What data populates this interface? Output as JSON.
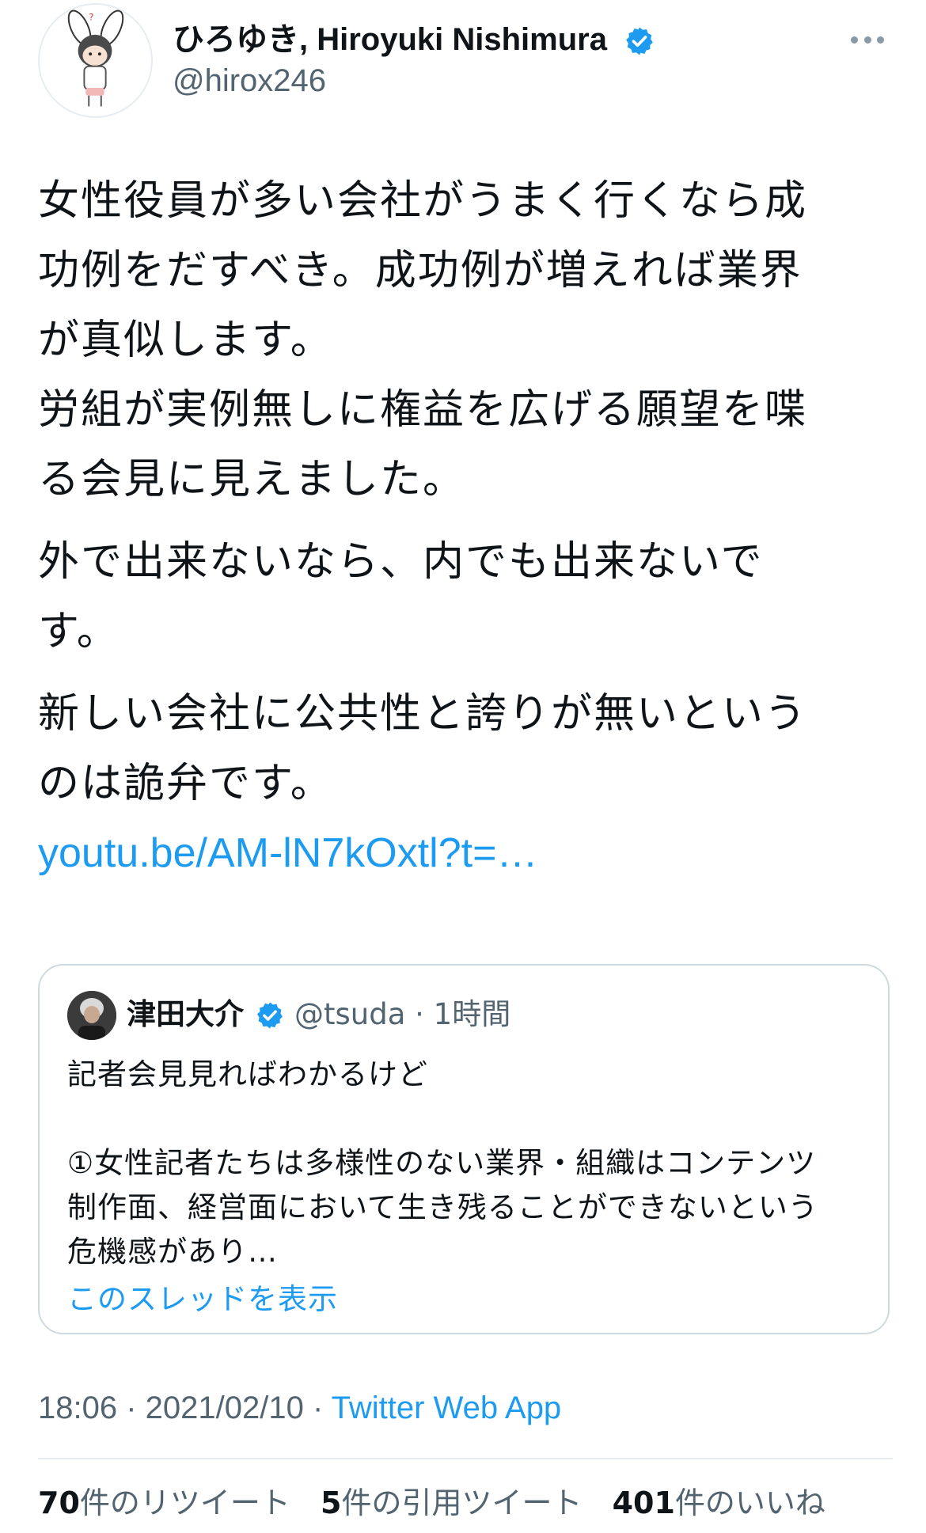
{
  "author": {
    "display_name": "ひろゆき, Hiroyuki Nishimura",
    "handle": "@hirox246",
    "verified_icon": "verified-badge-icon",
    "avatar_icon": "avatar-rabbit-eared-character"
  },
  "more_icon": "more-options-icon",
  "tweet": {
    "paragraphs": [
      [
        "女性役員が多い会社がうまく行くなら成",
        "功例をだすべき。成功例が増えれば業界",
        "が真似します。",
        "労組が実例無しに権益を広げる願望を喋",
        "る会見に見えました。"
      ],
      [
        "外で出来ないなら、内でも出来ないで",
        "す。"
      ],
      [
        "新しい会社に公共性と誇りが無いという",
        "のは詭弁です。"
      ]
    ],
    "link": "youtu.be/AM-lN7kOxtl?t=…"
  },
  "quote": {
    "name": "津田大介",
    "meta": "@tsuda · 1時間",
    "lines": [
      "記者会見見ればわかるけど",
      "",
      "①女性記者たちは多様性のない業界・組織はコンテンツ",
      "制作面、経営面において生き残ることができないという",
      "危機感があり…"
    ],
    "show_thread": "このスレッドを表示"
  },
  "meta": {
    "time_date": "18:06 · 2021/02/10 · ",
    "source": "Twitter Web App"
  },
  "stats": {
    "retweets_count": "70",
    "retweets_label": "件のリツイート",
    "quotes_count": "5",
    "quotes_label": "件の引用ツイート",
    "likes_count": "401",
    "likes_label": "件のいいね"
  },
  "colors": {
    "accent": "#1d9bf0",
    "secondary_text": "#536471",
    "border": "#cfd9de"
  }
}
